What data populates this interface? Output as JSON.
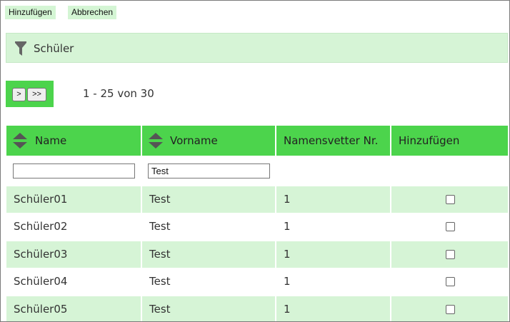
{
  "toolbar": {
    "add_label": "Hinzufügen",
    "cancel_label": "Abbrechen"
  },
  "filter_panel": {
    "title": "Schüler",
    "icon": "funnel-icon"
  },
  "pager": {
    "next_label": ">",
    "last_label": ">>",
    "info": "1 - 25 von 30"
  },
  "table": {
    "columns": [
      "Name",
      "Vorname",
      "Namensvetter Nr.",
      "Hinzufügen"
    ],
    "filters": {
      "name": "",
      "vorname": "Test"
    },
    "rows": [
      {
        "name": "Schüler01",
        "vorname": "Test",
        "nr": "1",
        "selected": false
      },
      {
        "name": "Schüler02",
        "vorname": "Test",
        "nr": "1",
        "selected": false
      },
      {
        "name": "Schüler03",
        "vorname": "Test",
        "nr": "1",
        "selected": false
      },
      {
        "name": "Schüler04",
        "vorname": "Test",
        "nr": "1",
        "selected": false
      },
      {
        "name": "Schüler05",
        "vorname": "Test",
        "nr": "1",
        "selected": false
      }
    ]
  },
  "colors": {
    "accent": "#4cd44c",
    "row_alt": "#d6f4d6",
    "button_bg": "#d4f5d4"
  }
}
